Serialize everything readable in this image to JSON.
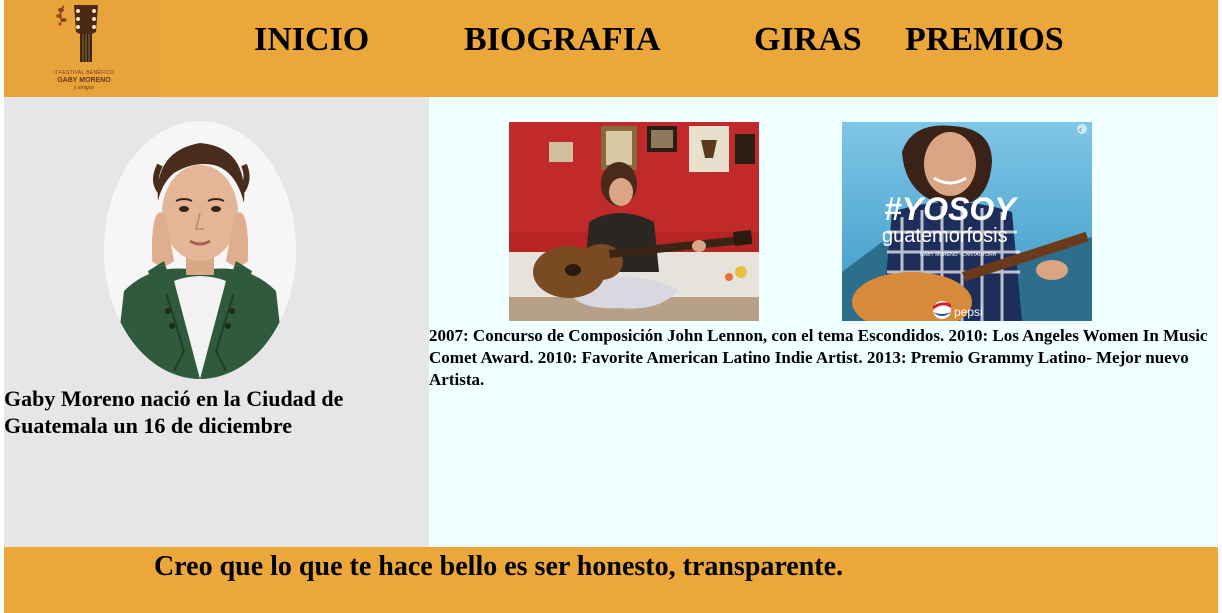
{
  "logo": {
    "small_text": "II FESTIVAL BENÉFICO",
    "main_text": "GABY MORENO",
    "sub_text": "y amigos",
    "icon": "guitar-icon"
  },
  "nav": {
    "items": [
      {
        "label": "INICIO"
      },
      {
        "label": "BIOGRAFIA"
      },
      {
        "label": "GIRAS"
      },
      {
        "label": "PREMIOS"
      }
    ]
  },
  "bio": {
    "text": "Gaby Moreno nació en la Ciudad de Guatemala un 16 de diciembre"
  },
  "photos": {
    "poster_title": "#YOSOY",
    "poster_subtitle": "guatemorfosis",
    "poster_caption": "GABY MORENO - CANTAUTORA",
    "poster_brand": "pepsi"
  },
  "awards": {
    "text": "2007: Concurso de Composición John Lennon, con el tema Escondidos. 2010: Los Angeles Women In Music Comet Award. 2010: Favorite American Latino Indie Artist. 2013: Premio Grammy Latino- Mejor nuevo Artista."
  },
  "footer": {
    "quote": "Creo que lo que te hace bello es ser honesto, transparente."
  },
  "colors": {
    "header_bg": "#EBA73A",
    "left_bg": "#E6E6E6",
    "right_bg": "#F0FFFF"
  }
}
